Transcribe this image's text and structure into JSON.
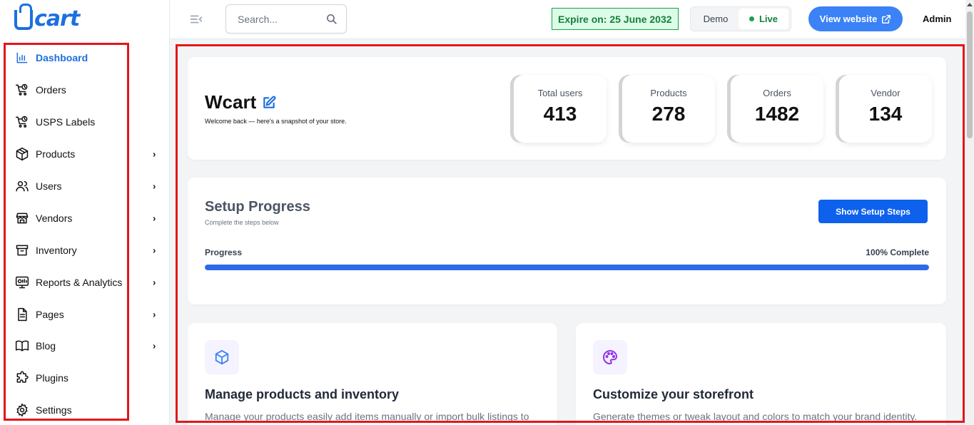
{
  "app": {
    "logo_text": "cart",
    "brand_color": "#1d6fe0"
  },
  "sidebar": {
    "items": [
      {
        "label": "Dashboard",
        "icon": "chart-bar-icon",
        "active": true,
        "has_children": false
      },
      {
        "label": "Orders",
        "icon": "cart-icon",
        "has_children": false
      },
      {
        "label": "USPS Labels",
        "icon": "cart-icon",
        "has_children": false
      },
      {
        "label": "Products",
        "icon": "box-icon",
        "has_children": true
      },
      {
        "label": "Users",
        "icon": "users-icon",
        "has_children": true
      },
      {
        "label": "Vendors",
        "icon": "store-icon",
        "has_children": true
      },
      {
        "label": "Inventory",
        "icon": "archive-icon",
        "has_children": true
      },
      {
        "label": "Reports & Analytics",
        "icon": "monitor-chart-icon",
        "has_children": true
      },
      {
        "label": "Pages",
        "icon": "document-icon",
        "has_children": true
      },
      {
        "label": "Blog",
        "icon": "book-icon",
        "has_children": true
      },
      {
        "label": "Plugins",
        "icon": "puzzle-icon",
        "has_children": false
      },
      {
        "label": "Settings",
        "icon": "gear-icon",
        "has_children": false
      }
    ],
    "chevron": "›"
  },
  "topbar": {
    "search_placeholder": "Search...",
    "expire_text": "Expire on: 25 June 2032",
    "mode_demo": "Demo",
    "mode_live": "Live",
    "view_website": "View website",
    "user": "Admin"
  },
  "hero": {
    "title": "Wcart",
    "subtitle": "Welcome back — here's a snapshot of your store.",
    "stats": [
      {
        "label": "Total users",
        "value": "413"
      },
      {
        "label": "Products",
        "value": "278"
      },
      {
        "label": "Orders",
        "value": "1482"
      },
      {
        "label": "Vendor",
        "value": "134"
      }
    ]
  },
  "setup": {
    "title": "Setup Progress",
    "subtitle": "Complete the steps below",
    "button": "Show Setup Steps",
    "progress_label": "Progress",
    "progress_text": "100% Complete",
    "progress_value": 100
  },
  "features": [
    {
      "title": "Manage products and inventory",
      "description": "Manage your products easily add items manually or import bulk listings to",
      "icon": "cube-icon",
      "icon_color": "#3b82f6"
    },
    {
      "title": "Customize your storefront",
      "description": "Generate themes or tweak layout and colors to match your brand identity.",
      "icon": "palette-icon",
      "icon_color": "#9333ea"
    }
  ]
}
